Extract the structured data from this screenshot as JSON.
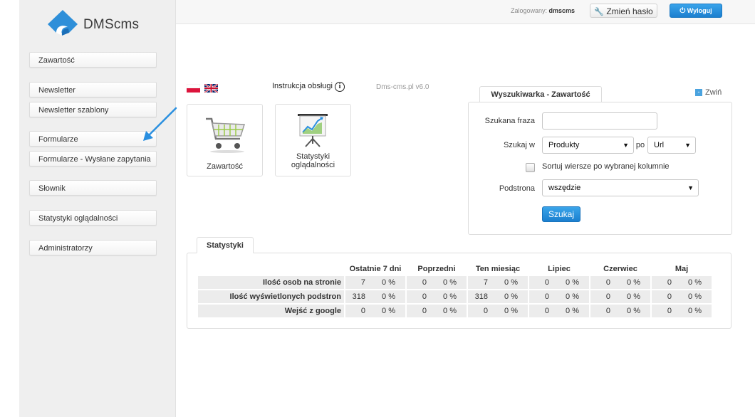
{
  "app": {
    "logo_text": "DMScms"
  },
  "colors": {
    "accent": "#1c85d6",
    "sidebar_bg": "#efefef"
  },
  "sidebar": {
    "items": [
      {
        "label": "Zawartość"
      },
      {
        "label": "Newsletter"
      },
      {
        "label": "Newsletter szablony"
      },
      {
        "label": "Formularze"
      },
      {
        "label": "Formularze - Wysłane zapytania"
      },
      {
        "label": "Słownik"
      },
      {
        "label": "Statystyki oglądalności"
      },
      {
        "label": "Administratorzy"
      }
    ]
  },
  "topbar": {
    "logged_label": "Zalogowany:",
    "username": "dmscms",
    "change_password": "Zmień hasło",
    "logout": "Wyloguj"
  },
  "toolbar": {
    "manual": "Instrukcja obsługi",
    "version": "Dms-cms.pl v6.0"
  },
  "tiles": [
    {
      "label": "Zawartość",
      "icon": "shopping-cart-icon"
    },
    {
      "label": "Statystyki oglądalności",
      "label_line1": "Statystyki",
      "label_line2": "oglądalności",
      "icon": "stats-presentation-icon"
    }
  ],
  "search": {
    "tab": "Wyszukiwarka - Zawartość",
    "collapse": "Zwiń",
    "phrase_label": "Szukana fraza",
    "phrase_value": "",
    "search_in_label": "Szukaj w",
    "search_in_value": "Produkty",
    "po_label": "po",
    "po_value": "Url",
    "sort_label": "Sortuj wiersze po wybranej kolumnie",
    "subpage_label": "Podstrona",
    "subpage_value": "wszędzie",
    "button": "Szukaj"
  },
  "stats": {
    "tab": "Statystyki",
    "columns": [
      "Ostatnie 7 dni",
      "Poprzedni",
      "Ten miesiąc",
      "Lipiec",
      "Czerwiec",
      "Maj"
    ],
    "rows": [
      {
        "label": "Ilość osob na stronie",
        "cells": [
          [
            "7",
            "0 %"
          ],
          [
            "0",
            "0 %"
          ],
          [
            "7",
            "0 %"
          ],
          [
            "0",
            "0 %"
          ],
          [
            "0",
            "0 %"
          ],
          [
            "0",
            "0 %"
          ]
        ]
      },
      {
        "label": "Ilość wyświetlonych podstron",
        "cells": [
          [
            "318",
            "0 %"
          ],
          [
            "0",
            "0 %"
          ],
          [
            "318",
            "0 %"
          ],
          [
            "0",
            "0 %"
          ],
          [
            "0",
            "0 %"
          ],
          [
            "0",
            "0 %"
          ]
        ]
      },
      {
        "label": "Wejść z google",
        "cells": [
          [
            "0",
            "0 %"
          ],
          [
            "0",
            "0 %"
          ],
          [
            "0",
            "0 %"
          ],
          [
            "0",
            "0 %"
          ],
          [
            "0",
            "0 %"
          ],
          [
            "0",
            "0 %"
          ]
        ]
      }
    ]
  }
}
